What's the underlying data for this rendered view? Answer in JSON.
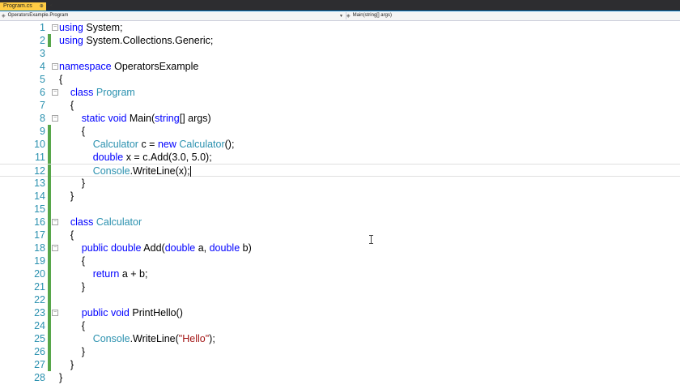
{
  "tab": {
    "label": "Program.cs",
    "pin_icon": "pin-icon",
    "close_icon": "close-icon"
  },
  "navbar": {
    "left": "OperatorsExample.Program",
    "right": "Main(string[] args)"
  },
  "code_lines": [
    {
      "n": "1",
      "tokens": [
        [
          "kw",
          "using"
        ],
        [
          "p",
          " System;"
        ]
      ],
      "fold": "minus"
    },
    {
      "n": "2",
      "tokens": [
        [
          "kw",
          "using"
        ],
        [
          "p",
          " System.Collections.Generic;"
        ]
      ],
      "changed": true
    },
    {
      "n": "3",
      "tokens": []
    },
    {
      "n": "4",
      "tokens": [
        [
          "kw",
          "namespace"
        ],
        [
          "p",
          " OperatorsExample"
        ]
      ],
      "fold": "minus"
    },
    {
      "n": "5",
      "tokens": [
        [
          "p",
          "{"
        ]
      ]
    },
    {
      "n": "6",
      "tokens": [
        [
          "p",
          "    "
        ],
        [
          "kw",
          "class"
        ],
        [
          "p",
          " "
        ],
        [
          "ty",
          "Program"
        ]
      ],
      "fold": "minus"
    },
    {
      "n": "7",
      "tokens": [
        [
          "p",
          "    {"
        ]
      ]
    },
    {
      "n": "8",
      "tokens": [
        [
          "p",
          "        "
        ],
        [
          "kw",
          "static"
        ],
        [
          "p",
          " "
        ],
        [
          "kw",
          "void"
        ],
        [
          "p",
          " Main("
        ],
        [
          "kw",
          "string"
        ],
        [
          "p",
          "[] args)"
        ]
      ],
      "fold": "minus"
    },
    {
      "n": "9",
      "tokens": [
        [
          "p",
          "        {"
        ]
      ],
      "changed": true
    },
    {
      "n": "10",
      "tokens": [
        [
          "p",
          "            "
        ],
        [
          "ty",
          "Calculator"
        ],
        [
          "p",
          " c = "
        ],
        [
          "kw",
          "new"
        ],
        [
          "p",
          " "
        ],
        [
          "ty",
          "Calculator"
        ],
        [
          "p",
          "();"
        ]
      ],
      "changed": true
    },
    {
      "n": "11",
      "tokens": [
        [
          "p",
          "            "
        ],
        [
          "kw",
          "double"
        ],
        [
          "p",
          " x = c.Add(3.0, 5.0);"
        ]
      ],
      "changed": true
    },
    {
      "n": "12",
      "tokens": [
        [
          "p",
          "            "
        ],
        [
          "ty",
          "Console"
        ],
        [
          "p",
          ".WriteLine(x);"
        ]
      ],
      "changed": true,
      "current": true
    },
    {
      "n": "13",
      "tokens": [
        [
          "p",
          "        }"
        ]
      ],
      "changed": true
    },
    {
      "n": "14",
      "tokens": [
        [
          "p",
          "    }"
        ]
      ],
      "changed": true
    },
    {
      "n": "15",
      "tokens": [],
      "changed": true
    },
    {
      "n": "16",
      "tokens": [
        [
          "p",
          "    "
        ],
        [
          "kw",
          "class"
        ],
        [
          "p",
          " "
        ],
        [
          "ty",
          "Calculator"
        ]
      ],
      "changed": true,
      "fold": "minus"
    },
    {
      "n": "17",
      "tokens": [
        [
          "p",
          "    {"
        ]
      ],
      "changed": true
    },
    {
      "n": "18",
      "tokens": [
        [
          "p",
          "        "
        ],
        [
          "kw",
          "public"
        ],
        [
          "p",
          " "
        ],
        [
          "kw",
          "double"
        ],
        [
          "p",
          " Add("
        ],
        [
          "kw",
          "double"
        ],
        [
          "p",
          " a, "
        ],
        [
          "kw",
          "double"
        ],
        [
          "p",
          " b)"
        ]
      ],
      "changed": true,
      "fold": "minus"
    },
    {
      "n": "19",
      "tokens": [
        [
          "p",
          "        {"
        ]
      ],
      "changed": true
    },
    {
      "n": "20",
      "tokens": [
        [
          "p",
          "            "
        ],
        [
          "kw",
          "return"
        ],
        [
          "p",
          " a + b;"
        ]
      ],
      "changed": true
    },
    {
      "n": "21",
      "tokens": [
        [
          "p",
          "        }"
        ]
      ],
      "changed": true
    },
    {
      "n": "22",
      "tokens": [],
      "changed": true
    },
    {
      "n": "23",
      "tokens": [
        [
          "p",
          "        "
        ],
        [
          "kw",
          "public"
        ],
        [
          "p",
          " "
        ],
        [
          "kw",
          "void"
        ],
        [
          "p",
          " PrintHello()"
        ]
      ],
      "changed": true,
      "fold": "minus"
    },
    {
      "n": "24",
      "tokens": [
        [
          "p",
          "        {"
        ]
      ],
      "changed": true
    },
    {
      "n": "25",
      "tokens": [
        [
          "p",
          "            "
        ],
        [
          "ty",
          "Console"
        ],
        [
          "p",
          ".WriteLine("
        ],
        [
          "st",
          "\"Hello\""
        ],
        [
          "p",
          ");"
        ]
      ],
      "changed": true
    },
    {
      "n": "26",
      "tokens": [
        [
          "p",
          "        }"
        ]
      ],
      "changed": true
    },
    {
      "n": "27",
      "tokens": [
        [
          "p",
          "    }"
        ]
      ],
      "changed": true
    },
    {
      "n": "28",
      "tokens": [
        [
          "p",
          "}"
        ]
      ]
    }
  ],
  "colors": {
    "keyword": "#0000ff",
    "type": "#2b91af",
    "string": "#a31515",
    "line_number": "#2b91af",
    "change_bar": "#57a64a",
    "tab": "#ffcc44"
  }
}
